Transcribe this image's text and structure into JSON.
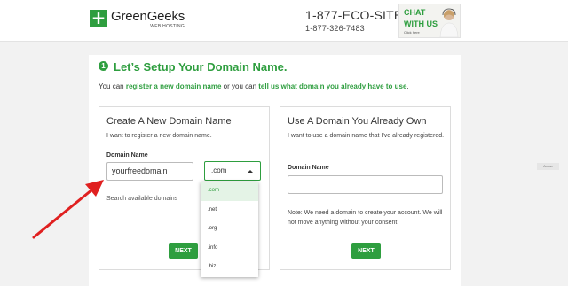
{
  "header": {
    "logo_name": "GreenGeeks",
    "logo_mark": "+",
    "logo_sub": "WEB HOSTING",
    "phone_vanity": "1-877-ECO-SITE",
    "phone_number": "1-877-326-7483",
    "chat_line1": "CHAT",
    "chat_line2": "WITH US",
    "chat_line3": "Click here"
  },
  "main": {
    "step_number": "1",
    "title": "Let’s Setup Your Domain Name.",
    "intro_prefix": "You can ",
    "intro_link1": "register a new domain name",
    "intro_middle": " or you can ",
    "intro_link2": "tell us what domain you already have to use",
    "intro_suffix": "."
  },
  "new_domain": {
    "title": "Create A New Domain Name",
    "description": "I want to register a new domain name.",
    "field_label": "Domain Name",
    "input_value": "yourfreedomain",
    "selected_tld": ".com",
    "search_text": "Search available domains",
    "next_label": "NEXT"
  },
  "tld_options": [
    ".com",
    ".net",
    ".org",
    ".info",
    ".biz"
  ],
  "existing_domain": {
    "title": "Use A Domain You Already Own",
    "description": "I want to use a domain name that I've already registered.",
    "field_label": "Domain Name",
    "input_value": "",
    "note": "Note: We need a domain to create your account. We will not move anything without your consent.",
    "next_label": "NEXT"
  },
  "annotation": {
    "arrow_label": "Arrow"
  },
  "colors": {
    "brand_green": "#2e9e3f",
    "annotation_red": "#e02020"
  }
}
